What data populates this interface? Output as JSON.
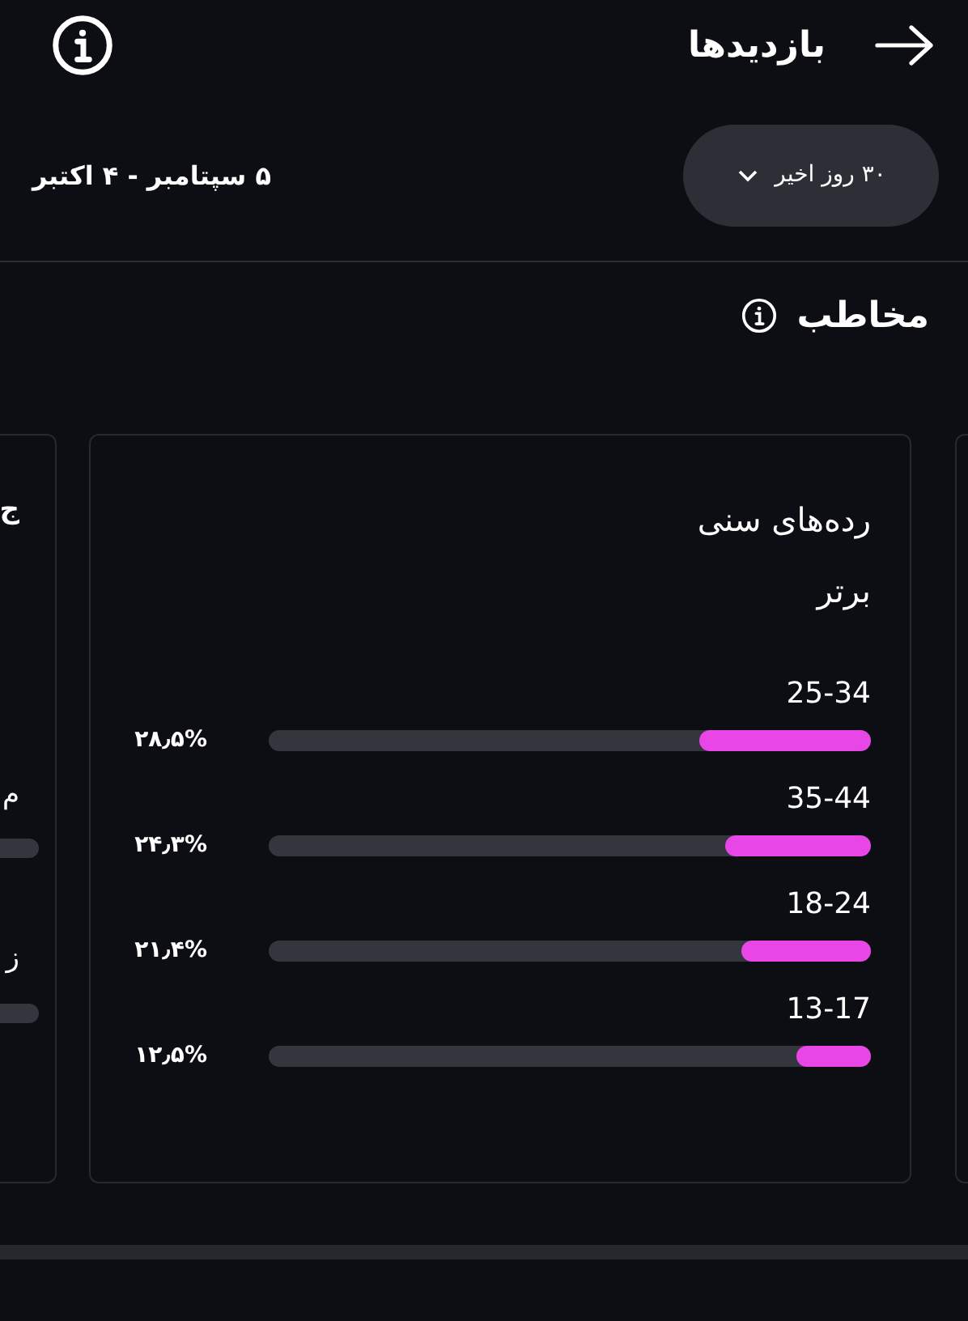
{
  "header": {
    "title": "بازدیدها"
  },
  "range": {
    "dropdown": "۳۰ روز اخیر",
    "dates": "۵ سپتامبر - ۴ اکتبر"
  },
  "section": {
    "title": "مخاطب"
  },
  "left_card": {
    "texts": [
      "ج",
      "م",
      "ز"
    ]
  },
  "age_card": {
    "title": "رده‌های سنی برتر",
    "rows": [
      {
        "label": "25-34",
        "value": "۲۸٫۵%",
        "level": 0.285
      },
      {
        "label": "35-44",
        "value": "۲۴٫۳%",
        "level": 0.243
      },
      {
        "label": "18-24",
        "value": "۲۱٫۴%",
        "level": 0.214
      },
      {
        "label": "13-17",
        "value": "۱۲٫۵%",
        "level": 0.125
      }
    ]
  }
}
